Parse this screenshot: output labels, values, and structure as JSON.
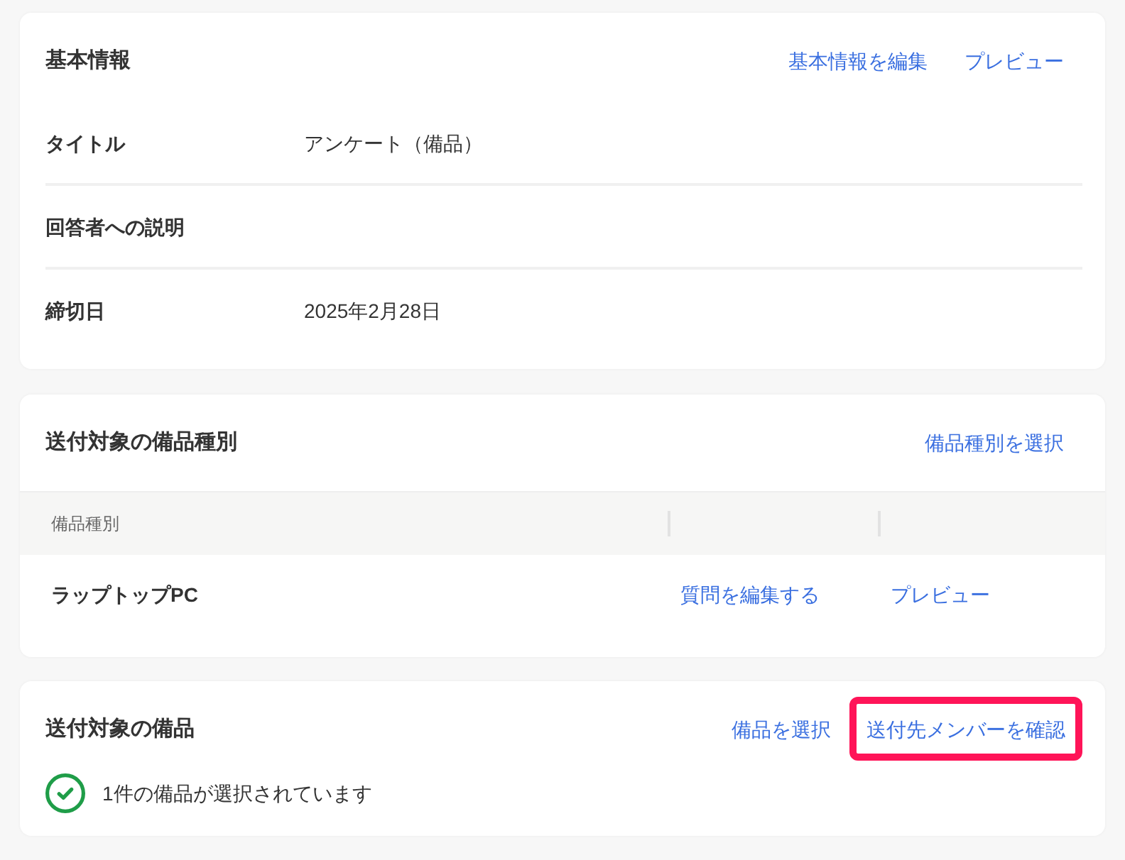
{
  "sections": [
    {
      "kind": "fields",
      "title": "基本情報",
      "actions": [
        {
          "label": "基本情報を編集",
          "highlighted": false
        },
        {
          "label": "プレビュー",
          "highlighted": false
        }
      ],
      "fields": [
        {
          "label": "タイトル",
          "value": "アンケート（備品）"
        },
        {
          "label": "回答者への説明"
        },
        {
          "label": "締切日",
          "value": "2025年2月28日"
        }
      ]
    },
    {
      "kind": "table",
      "title": "送付対象の備品種別",
      "actions": [
        {
          "label": "備品種別を選択",
          "highlighted": false
        }
      ],
      "table": {
        "columns": [
          "備品種別"
        ],
        "rows": [
          {
            "name": "ラップトップPC",
            "actions": [
              "質問を編集する",
              "プレビュー"
            ]
          }
        ]
      }
    },
    {
      "kind": "status",
      "title": "送付対象の備品",
      "actions": [
        {
          "label": "備品を選択",
          "highlighted": false
        },
        {
          "label": "送付先メンバーを確認",
          "highlighted": true
        }
      ],
      "status": {
        "kind": "success",
        "text": "1件の備品が選択されています"
      }
    }
  ]
}
